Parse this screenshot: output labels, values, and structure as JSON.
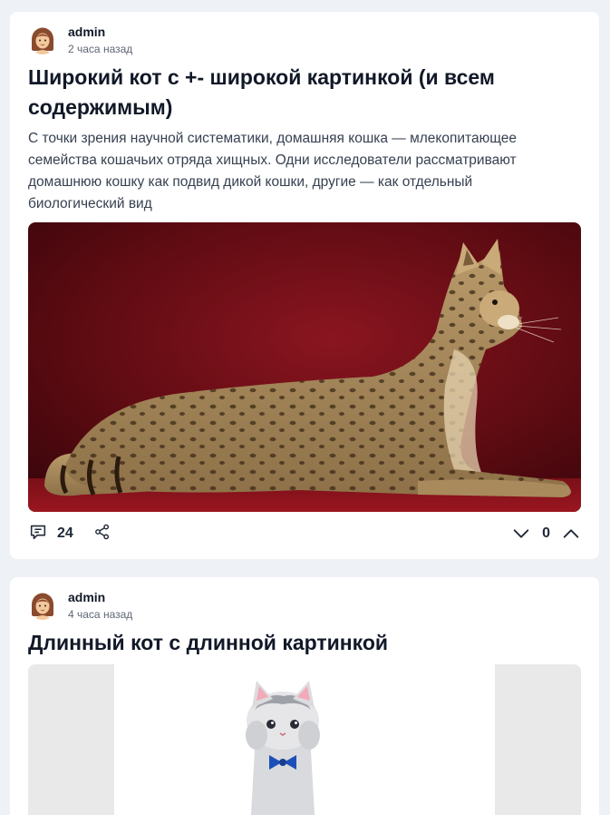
{
  "posts": [
    {
      "author": "admin",
      "time": "2 часа назад",
      "title": "Широкий кот с +- широкой картинкой (и всем содержимым)",
      "text": "С точки зрения научной систематики, домашняя кошка — млекопитающее семейства кошачьих отряда хищных. Одни исследователи рассматривают домашнюю кошку как подвид дикой кошки, другие — как отдельный биологический вид",
      "image": "savannah-cat-photo",
      "comments_count": "24",
      "votes": "0"
    },
    {
      "author": "admin",
      "time": "4 часа назад",
      "title": "Длинный кот с длинной картинкой",
      "image": "plush-cat-toy-photo"
    }
  ],
  "icons": {
    "comments": "comment-icon",
    "share": "share-icon",
    "downvote": "chevron-down-icon",
    "upvote": "chevron-up-icon"
  },
  "colors": {
    "page_background": "#eef1f6",
    "card_background": "#ffffff",
    "image_backdrop": "#6b0d14"
  }
}
